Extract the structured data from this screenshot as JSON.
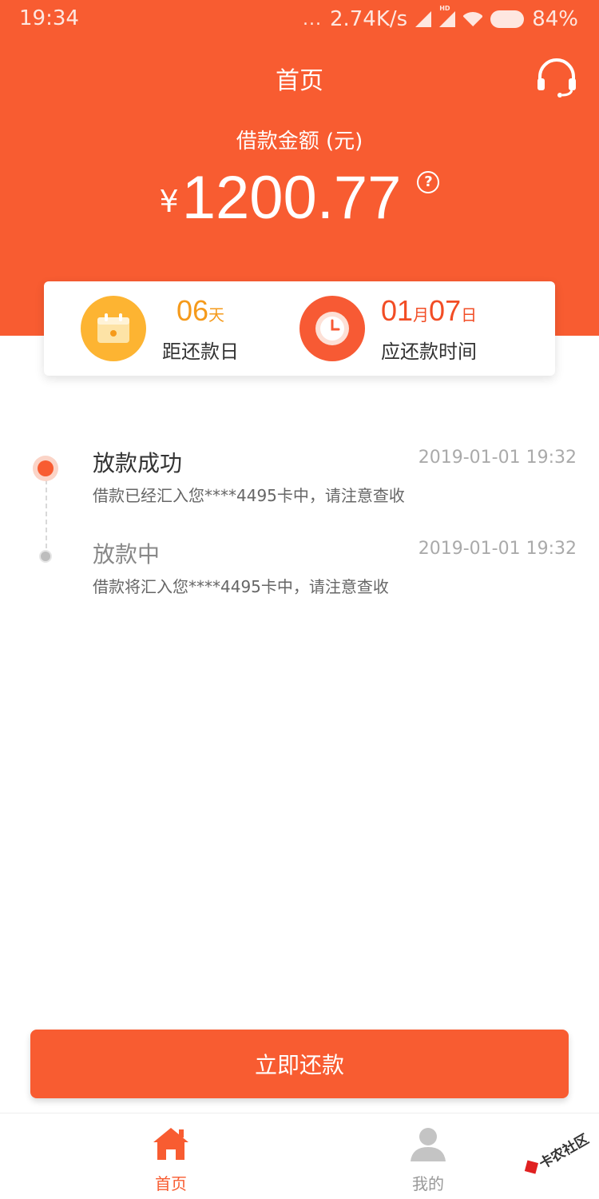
{
  "status_bar": {
    "time": "19:34",
    "dots": "...",
    "network_speed": "2.74K/s",
    "hd_label": "HD",
    "battery": "84%"
  },
  "header": {
    "title": "首页",
    "support_icon": "headset-icon"
  },
  "loan": {
    "amount_label": "借款金额 (元)",
    "currency_symbol": "¥",
    "amount": "1200.77",
    "help_icon_glyph": "?"
  },
  "info_card": {
    "days_left": {
      "value": "06",
      "unit": "天",
      "label": "距还款日",
      "icon": "calendar-icon",
      "color": "#fdb432"
    },
    "due_date": {
      "month": "01",
      "month_unit": "月",
      "day": "07",
      "day_unit": "日",
      "label": "应还款时间",
      "icon": "clock-icon",
      "color": "#f75a34"
    }
  },
  "timeline": [
    {
      "title": "放款成功",
      "time": "2019-01-01 19:32",
      "description": "借款已经汇入您****4495卡中，请注意查收",
      "active": true
    },
    {
      "title": "放款中",
      "time": "2019-01-01 19:32",
      "description": "借款将汇入您****4495卡中，请注意查收",
      "active": false
    }
  ],
  "pay_button": {
    "label": "立即还款"
  },
  "tab_bar": {
    "items": [
      {
        "label": "首页",
        "icon": "home-icon",
        "active": true
      },
      {
        "label": "我的",
        "icon": "user-icon",
        "active": false
      }
    ]
  },
  "watermark": {
    "text": "卡农社区"
  },
  "colors": {
    "brand": "#f85c31",
    "accent_yellow": "#fdb432"
  }
}
